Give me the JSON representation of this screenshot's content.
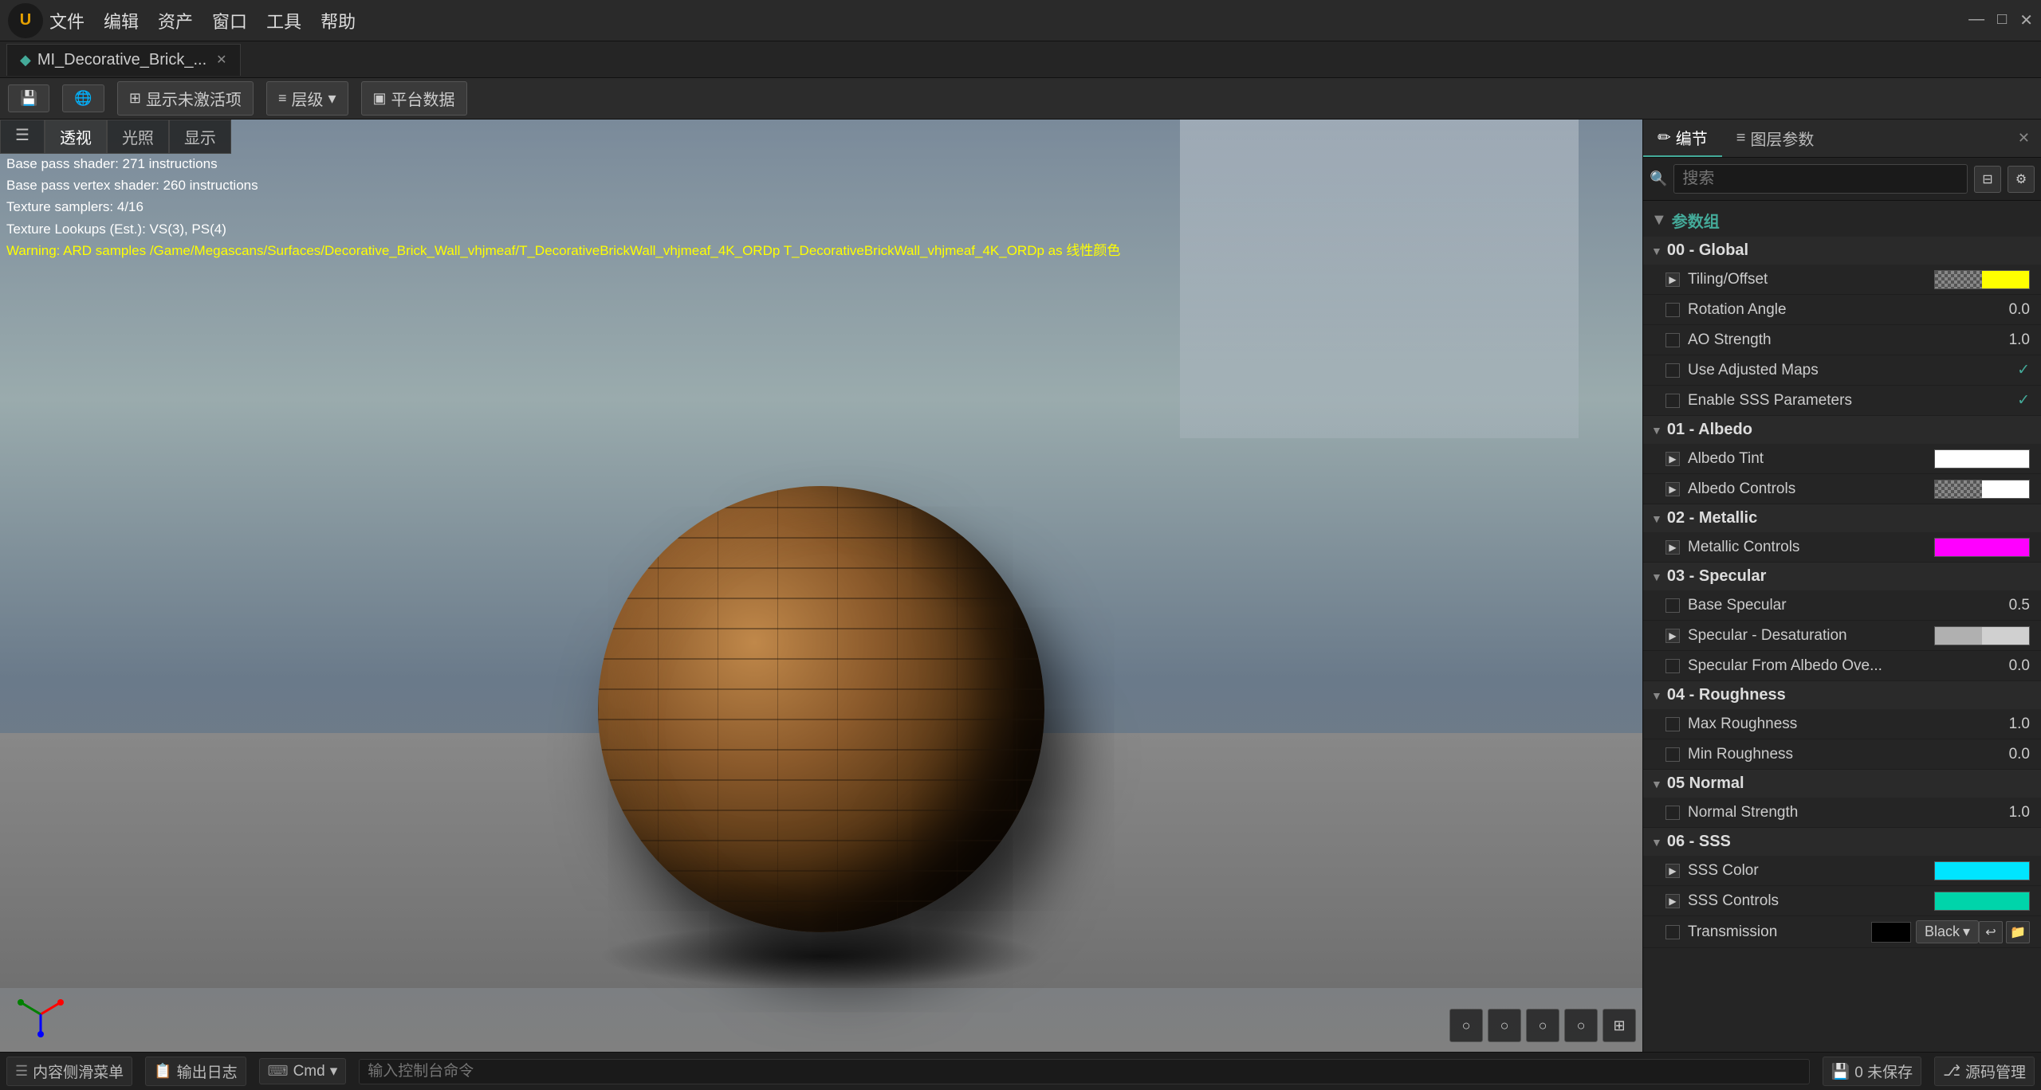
{
  "titlebar": {
    "logo": "U",
    "menus": [
      "文件",
      "编辑",
      "资产",
      "窗口",
      "工具",
      "帮助"
    ],
    "tab_label": "MI_Decorative_Brick_...",
    "tab_icon": "◆",
    "close": "✕",
    "win_min": "—",
    "win_restore": "□",
    "win_close": "✕"
  },
  "toolbar": {
    "save_icon": "💾",
    "world_icon": "🌐",
    "display_label": "显示未激活项",
    "layer_label": "层级",
    "layer_icon": "≡",
    "platform_label": "平台数据",
    "platform_icon": "▣"
  },
  "viewport": {
    "tabs": [
      "透视",
      "光照",
      "显示"
    ],
    "debug_lines": [
      {
        "text": "Base pass shader: 271 instructions",
        "color": "white"
      },
      {
        "text": "Base pass vertex shader: 260 instructions",
        "color": "white"
      },
      {
        "text": "Texture samplers: 4/16",
        "color": "white"
      },
      {
        "text": "Texture Lookups (Est.): VS(3), PS(4)",
        "color": "white"
      },
      {
        "text": "Warning: ARD samples /Game/Megascans/Surfaces/Decorative_Brick_Wall_vhjmeaf/T_DecorativeBrickWall_vhjmeaf_4K_ORDp T_DecorativeBrickWall_vhjmeaf_4K_ORDp as 线性颜色",
        "color": "yellow"
      }
    ],
    "viewport_icons": [
      "○",
      "○",
      "○",
      "○",
      "⊞"
    ]
  },
  "right_panel": {
    "tabs": [
      {
        "label": "编节",
        "icon": "✏"
      },
      {
        "label": "图层参数",
        "icon": "≡"
      }
    ],
    "search_placeholder": "搜索",
    "params_group_label": "参数组",
    "groups": [
      {
        "label": "00 - Global",
        "expanded": true,
        "params": [
          {
            "type": "expand",
            "label": "Tiling/Offset",
            "swatch": [
              {
                "type": "checker"
              },
              {
                "type": "color",
                "color": "#ffff00"
              }
            ],
            "has_swatch": true
          },
          {
            "type": "checkbox",
            "label": "Rotation Angle",
            "value": "0.0"
          },
          {
            "type": "checkbox",
            "label": "AO Strength",
            "value": "1.0"
          },
          {
            "type": "checkbox",
            "label": "Use Adjusted Maps",
            "value": "✓"
          },
          {
            "type": "checkbox",
            "label": "Enable SSS Parameters",
            "value": "✓"
          }
        ]
      },
      {
        "label": "01 - Albedo",
        "expanded": true,
        "params": [
          {
            "type": "expand",
            "label": "Albedo Tint",
            "swatch": [
              {
                "type": "color",
                "color": "#fff"
              },
              {
                "type": "color",
                "color": "#fff"
              }
            ],
            "has_swatch": true
          },
          {
            "type": "expand",
            "label": "Albedo Controls",
            "swatch": [
              {
                "type": "checker"
              },
              {
                "type": "color",
                "color": "#fff"
              }
            ],
            "has_swatch": true
          }
        ]
      },
      {
        "label": "02 - Metallic",
        "expanded": true,
        "params": [
          {
            "type": "expand",
            "label": "Metallic Controls",
            "swatch": [
              {
                "type": "color",
                "color": "#ff00ff"
              },
              {
                "type": "color",
                "color": "#ff00ff"
              }
            ],
            "has_swatch": true
          }
        ]
      },
      {
        "label": "03 - Specular",
        "expanded": true,
        "params": [
          {
            "type": "checkbox",
            "label": "Base Specular",
            "value": "0.5"
          },
          {
            "type": "expand",
            "label": "Specular - Desaturation",
            "swatch": [
              {
                "type": "color",
                "color": "#b0b0b0"
              },
              {
                "type": "color",
                "color": "#d0d0d0"
              }
            ],
            "has_swatch": true
          },
          {
            "type": "checkbox",
            "label": "Specular From Albedo Ove...",
            "value": "0.0"
          }
        ]
      },
      {
        "label": "04 - Roughness",
        "expanded": true,
        "params": [
          {
            "type": "checkbox",
            "label": "Max Roughness",
            "value": "1.0"
          },
          {
            "type": "checkbox",
            "label": "Min Roughness",
            "value": "0.0"
          }
        ]
      },
      {
        "label": "05 Normal",
        "expanded": true,
        "params": [
          {
            "type": "checkbox",
            "label": "Normal Strength",
            "value": "1.0"
          }
        ]
      },
      {
        "label": "06 - SSS",
        "expanded": true,
        "params": [
          {
            "type": "expand",
            "label": "SSS Color",
            "swatch": [
              {
                "type": "color",
                "color": "#00e5ff"
              },
              {
                "type": "color",
                "color": "#00e5ff"
              }
            ],
            "has_swatch": true
          },
          {
            "type": "expand",
            "label": "SSS Controls",
            "swatch": [
              {
                "type": "color",
                "color": "#00d4aa"
              },
              {
                "type": "color",
                "color": "#00d4aa"
              }
            ],
            "has_swatch": true
          }
        ]
      }
    ],
    "transmission": {
      "label": "Transmission",
      "black_label": "Black",
      "dropdown_arrow": "▾"
    }
  },
  "statusbar": {
    "items": [
      {
        "icon": "☰",
        "label": "内容侧滑菜单"
      },
      {
        "icon": "📋",
        "label": "输出日志"
      },
      {
        "icon": "⌨",
        "label": "Cmd"
      },
      {
        "icon": "",
        "label": "输入控制台命令"
      }
    ],
    "right_items": [
      {
        "label": "0 未保存"
      },
      {
        "label": "源码管理"
      }
    ]
  }
}
